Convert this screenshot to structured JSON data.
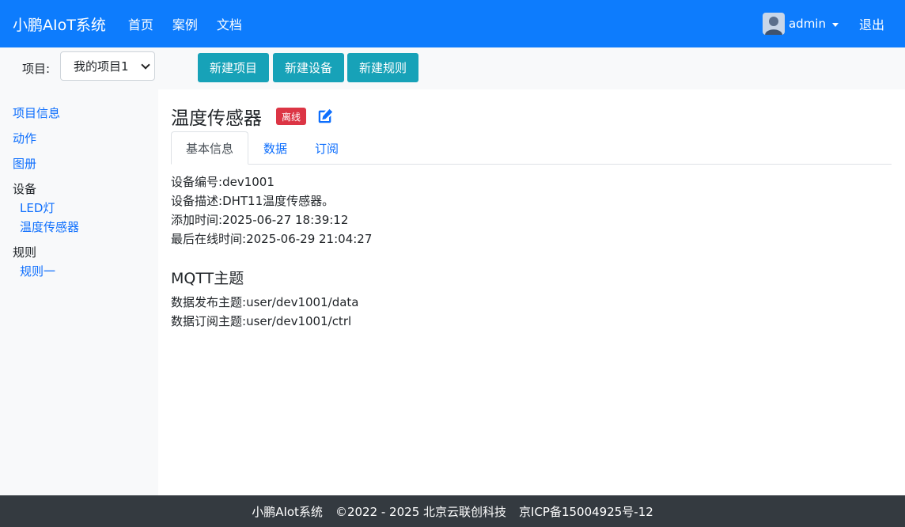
{
  "navbar": {
    "brand": "小鹏AIoT系统",
    "links": [
      "首页",
      "案例",
      "文档"
    ],
    "user": "admin",
    "logout": "退出",
    "color": "#0d7cfd"
  },
  "toolbar": {
    "project_label": "项目:",
    "project_selected": "我的项目1",
    "buttons": [
      "新建项目",
      "新建设备",
      "新建规则"
    ],
    "button_color": "#17a2b8"
  },
  "sidebar": {
    "project_info": "项目信息",
    "actions": "动作",
    "charts": "图册",
    "devices_heading": "设备",
    "devices": [
      "LED灯",
      "温度传感器"
    ],
    "rules_heading": "规则",
    "rules": [
      "规则一"
    ]
  },
  "device": {
    "title": "温度传感器",
    "status": "离线",
    "status_color": "#dc3545",
    "edit_icon": "edit-icon"
  },
  "tabs": [
    "基本信息",
    "数据",
    "订阅"
  ],
  "info": {
    "id_label": "设备编号:",
    "id_value": "dev1001",
    "desc_label": "设备描述:",
    "desc_value": "DHT11温度传感器。",
    "added_label": "添加时间:",
    "added_value": "2025-06-27 18:39:12",
    "last_online_label": "最后在线时间:",
    "last_online_value": "2025-06-29 21:04:27"
  },
  "mqtt": {
    "title": "MQTT主题",
    "publish_label": "数据发布主题:",
    "publish_value": "user/dev1001/data",
    "subscribe_label": "数据订阅主题:",
    "subscribe_value": "user/dev1001/ctrl"
  },
  "footer": {
    "name": "小鹏AIot系统",
    "copyright": "©2022 - 2025 北京云联创科技",
    "icp": "京ICP备15004925号-12"
  }
}
